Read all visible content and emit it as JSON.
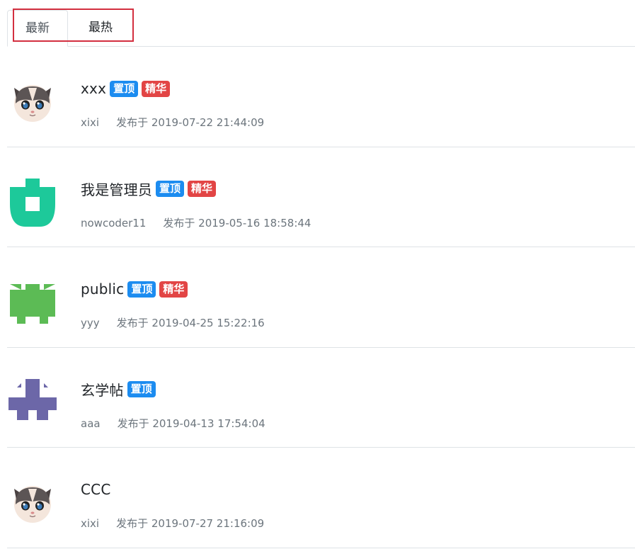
{
  "tabs": [
    {
      "label": "最新",
      "active": true
    },
    {
      "label": "最热",
      "active": false
    }
  ],
  "badges": {
    "pin": "置顶",
    "wonderful": "精华"
  },
  "colors": {
    "pin_badge": "#1c8cf0",
    "wonderful_badge": "#e24545",
    "active_tab_outline": "#d32f3f"
  },
  "posts": [
    {
      "title": "xxx",
      "author": "xixi",
      "published": "发布于 2019-07-22 21:44:09",
      "pinned": true,
      "wonderful": true,
      "avatar": "cat-avatar"
    },
    {
      "title": "我是管理员",
      "author": "nowcoder11",
      "published": "发布于 2019-05-16 18:58:44",
      "pinned": true,
      "wonderful": true,
      "avatar": "green-identicon-avatar"
    },
    {
      "title": "public",
      "author": "yyy",
      "published": "发布于 2019-04-25 15:22:16",
      "pinned": true,
      "wonderful": true,
      "avatar": "lime-identicon-avatar"
    },
    {
      "title": "玄学帖",
      "author": "aaa",
      "published": "发布于 2019-04-13 17:54:04",
      "pinned": true,
      "wonderful": false,
      "avatar": "purple-identicon-avatar"
    },
    {
      "title": "CCC",
      "author": "xixi",
      "published": "发布于 2019-07-27 21:16:09",
      "pinned": false,
      "wonderful": false,
      "avatar": "cat-avatar"
    }
  ]
}
